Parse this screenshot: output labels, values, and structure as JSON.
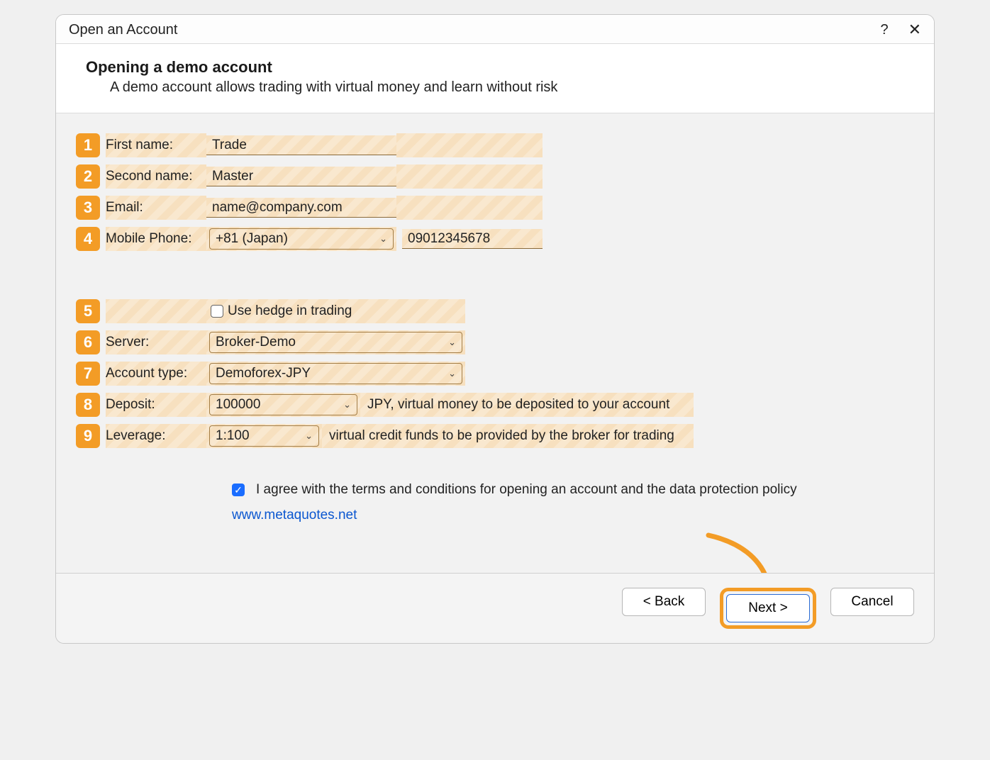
{
  "window": {
    "title": "Open an Account"
  },
  "header": {
    "title": "Opening a demo account",
    "subtitle": "A demo account allows trading with virtual money and learn without risk"
  },
  "fields": {
    "first_name": {
      "label": "First name:",
      "value": "Trade"
    },
    "second_name": {
      "label": "Second name:",
      "value": "Master"
    },
    "email": {
      "label": "Email:",
      "value": "name@company.com"
    },
    "phone": {
      "label": "Mobile Phone:",
      "country": "+81 (Japan)",
      "number": "09012345678"
    },
    "hedge": {
      "label": "Use hedge in trading",
      "checked": false
    },
    "server": {
      "label": "Server:",
      "value": "Broker-Demo"
    },
    "account_type": {
      "label": "Account type:",
      "value": "Demoforex-JPY"
    },
    "deposit": {
      "label": "Deposit:",
      "value": "100000",
      "hint": "JPY, virtual money to be deposited to your account"
    },
    "leverage": {
      "label": "Leverage:",
      "value": "1:100",
      "hint": "virtual credit funds to be provided by the broker for trading"
    }
  },
  "badges": [
    "1",
    "2",
    "3",
    "4",
    "5",
    "6",
    "7",
    "8",
    "9"
  ],
  "agree": {
    "text": "I agree with the terms and conditions for opening an account and the data protection policy",
    "checked": true,
    "link": "www.metaquotes.net"
  },
  "buttons": {
    "back": "< Back",
    "next": "Next >",
    "cancel": "Cancel"
  }
}
